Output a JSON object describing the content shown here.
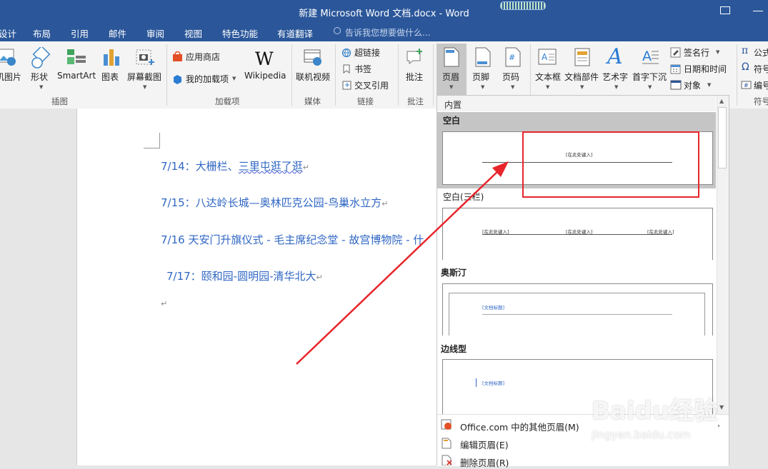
{
  "window": {
    "title": "新建 Microsoft Word 文档.docx - Word"
  },
  "tabs": [
    "设计",
    "布局",
    "引用",
    "邮件",
    "审阅",
    "视图",
    "特色功能",
    "有道翻译"
  ],
  "tell_me": "告诉我您想要做什么...",
  "ribbon": {
    "illustrations": {
      "online_pictures": "机图片",
      "shapes": "形状",
      "smartart": "SmartArt",
      "chart": "图表",
      "screenshot": "屏幕截图",
      "group": "插图"
    },
    "addins": {
      "store": "应用商店",
      "my_addins": "我的加载项",
      "wikipedia": "Wikipedia",
      "group": "加载项"
    },
    "media": {
      "online_video": "联机视频",
      "group": "媒体"
    },
    "links": {
      "hyperlink": "超链接",
      "bookmark": "书签",
      "cross_reference": "交叉引用",
      "group": "链接"
    },
    "comments": {
      "comment": "批注",
      "group": "批注"
    },
    "header_footer": {
      "header": "页眉",
      "footer": "页脚",
      "page_number": "页码"
    },
    "text": {
      "text_box": "文本框",
      "quick_parts": "文档部件",
      "wordart": "艺术字",
      "drop_cap": "首字下沉",
      "signature_line": "签名行",
      "date_time": "日期和时间",
      "object": "对象"
    },
    "symbols": {
      "equation": "公式",
      "symbol": "符号",
      "number": "编号",
      "group": "符号"
    }
  },
  "document": {
    "lines": [
      {
        "prefix": "7/14：大栅栏、",
        "squiggle": "三里屯逛了逛"
      },
      {
        "text": "7/15：八达岭长城—奥林匹克公园-鸟巢水立方"
      },
      {
        "text": "7/16 天安门升旗仪式 - 毛主席纪念堂 - 故宫博物院 - 什"
      },
      {
        "text": "7/17：颐和园-圆明园-清华北大"
      }
    ],
    "paragraph_mark": "↵"
  },
  "gallery": {
    "section": "内置",
    "items": [
      {
        "name": "空白",
        "placeholder": "[在此处键入]"
      },
      {
        "name": "空白(三栏)",
        "placeholder": "[在此处键入]"
      },
      {
        "name": "奥斯汀",
        "placeholder": "[文档标题]"
      },
      {
        "name": "边线型",
        "placeholder": "[文档标题]"
      }
    ],
    "menu": [
      "Office.com 中的其他页眉(M)",
      "编辑页眉(E)",
      "删除页眉(R)"
    ]
  },
  "watermark": {
    "brand": "Baidu经验",
    "url": "jingyan.baidu.com"
  },
  "colors": {
    "title_bar": "#2b579a",
    "link_text": "#2f66c4",
    "annotation": "#e8252a"
  }
}
